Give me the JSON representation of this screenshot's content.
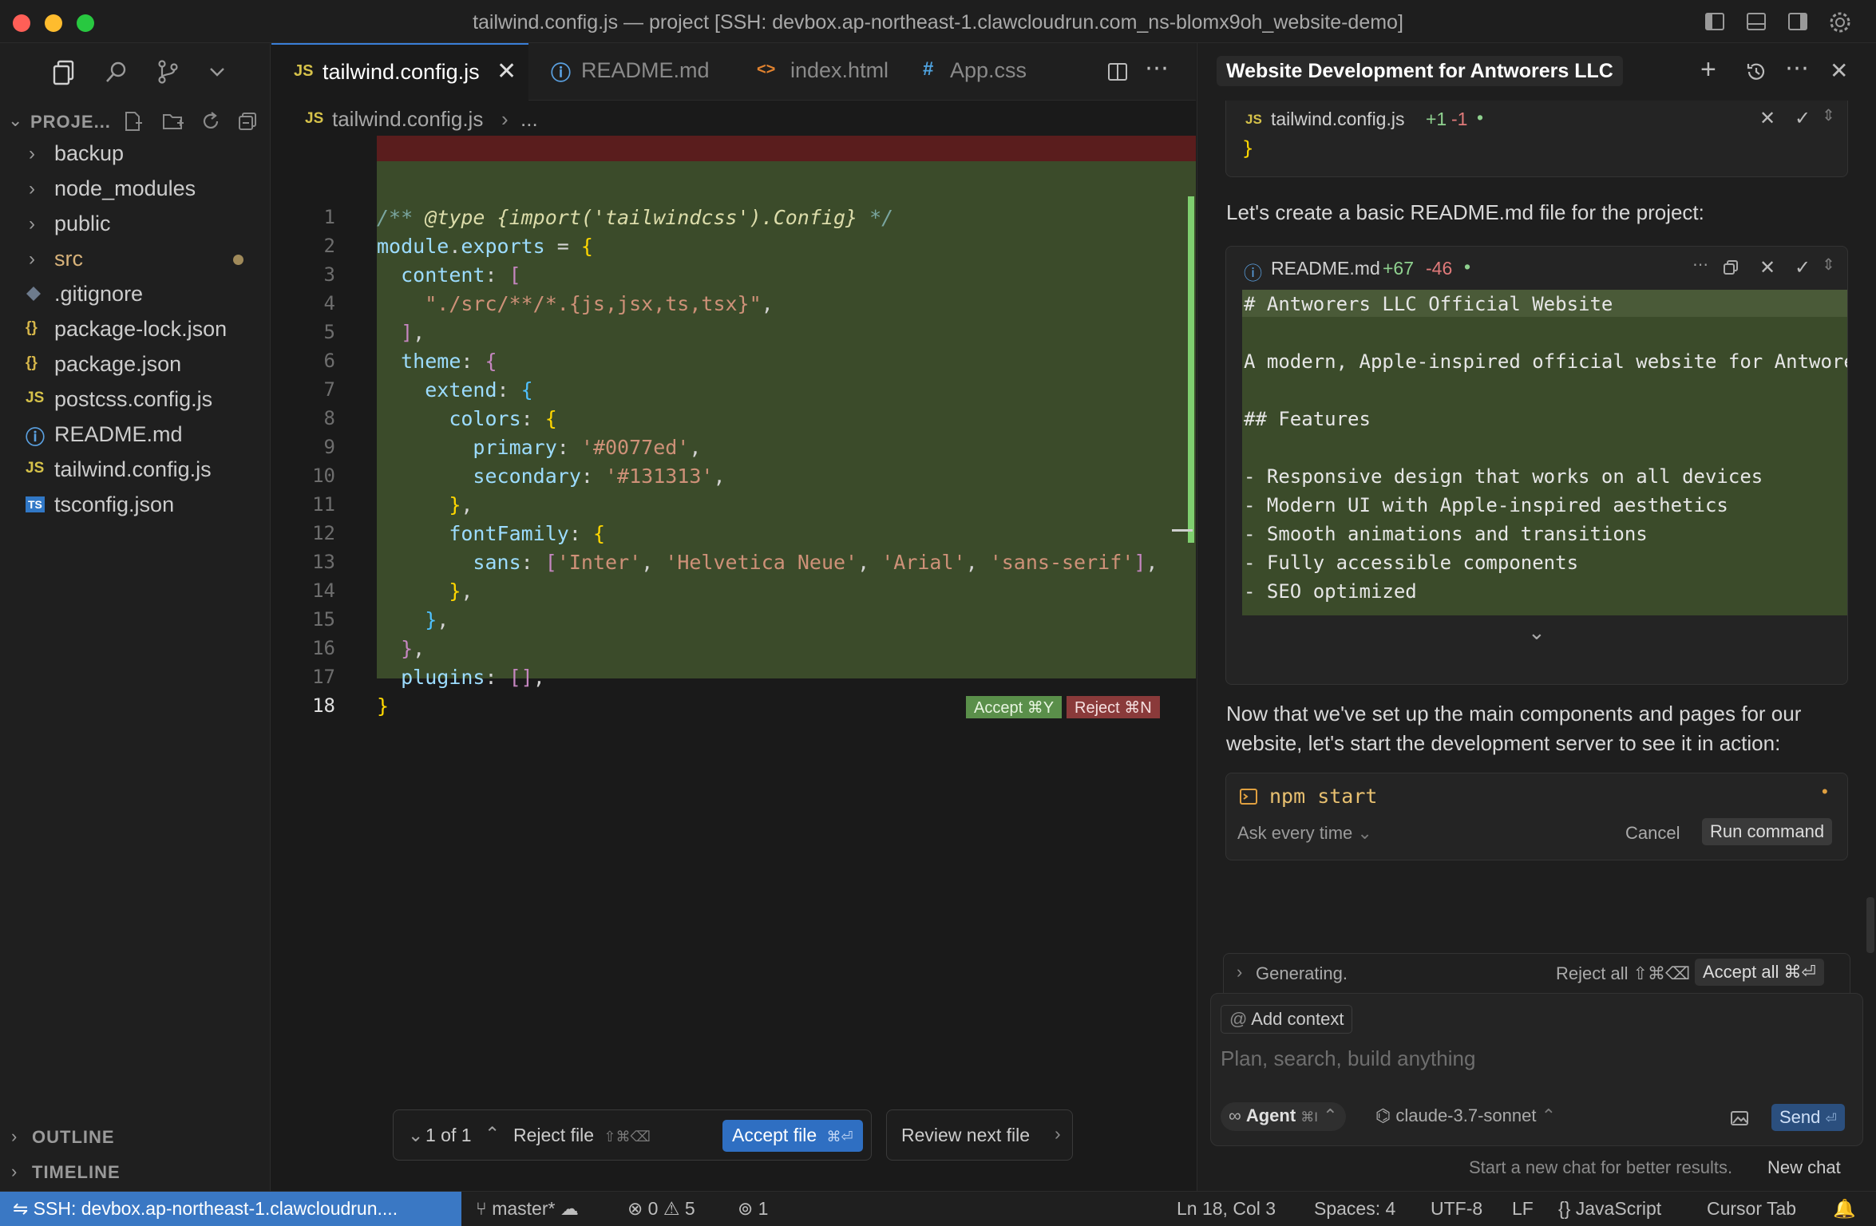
{
  "window": {
    "title": "tailwind.config.js — project [SSH: devbox.ap-northeast-1.clawcloudrun.com_ns-blomx9oh_website-demo]"
  },
  "explorer": {
    "title": "PROJE...",
    "items": [
      {
        "label": "backup",
        "kind": "folder"
      },
      {
        "label": "node_modules",
        "kind": "folder"
      },
      {
        "label": "public",
        "kind": "folder"
      },
      {
        "label": "src",
        "kind": "folder"
      },
      {
        "label": ".gitignore",
        "kind": "git"
      },
      {
        "label": "package-lock.json",
        "kind": "json",
        "icon": "{}"
      },
      {
        "label": "package.json",
        "kind": "json",
        "icon": "{}"
      },
      {
        "label": "postcss.config.js",
        "kind": "js",
        "icon": "JS"
      },
      {
        "label": "README.md",
        "kind": "info",
        "icon": "ⓘ"
      },
      {
        "label": "tailwind.config.js",
        "kind": "js",
        "icon": "JS"
      },
      {
        "label": "tsconfig.json",
        "kind": "ts",
        "icon": "TS"
      }
    ],
    "outline": "OUTLINE",
    "timeline": "TIMELINE"
  },
  "tabs": [
    {
      "label": "tailwind.config.js",
      "icon": "JS"
    },
    {
      "label": "README.md",
      "icon": "ⓘ"
    },
    {
      "label": "index.html",
      "icon": "<>"
    },
    {
      "label": "App.css",
      "icon": "#"
    }
  ],
  "breadcrumb": {
    "file": "tailwind.config.js",
    "rest": "..."
  },
  "code": {
    "line_numbers": [
      "1",
      "2",
      "3",
      "4",
      "5",
      "6",
      "7",
      "8",
      "9",
      "10",
      "11",
      "12",
      "13",
      "14",
      "15",
      "16",
      "17",
      "18"
    ],
    "accept_label": "Accept ⌘Y",
    "reject_label": "Reject ⌘N"
  },
  "review_bar": {
    "counter": "1 of 1",
    "reject_file": "Reject file",
    "reject_shortcut": "⇧⌘⌫",
    "accept_file": "Accept file",
    "accept_shortcut": "⌘⏎",
    "review_next": "Review next file"
  },
  "chat": {
    "title": "Website Development for Antworers LLC",
    "file_card_1": {
      "name": "tailwind.config.js",
      "added": "+1",
      "removed": "-1",
      "brace": "}"
    },
    "msg_1": "Let's create a basic README.md file for the project:",
    "file_card_2": {
      "name": "README.md",
      "added": "+67",
      "removed": "-46",
      "lines": [
        "# Antworers LLC Official Website",
        "",
        "A modern, Apple-inspired official website for Antwore",
        "",
        "## Features",
        "",
        "- Responsive design that works on all devices",
        "- Modern UI with Apple-inspired aesthetics",
        "- Smooth animations and transitions",
        "- Fully accessible components",
        "- SEO optimized"
      ]
    },
    "msg_2": "Now that we've set up the main components and pages for our website, let's start the development server to see it in action:",
    "command_card": {
      "command": "npm start",
      "mode": "Ask every time",
      "cancel": "Cancel",
      "run": "Run command"
    },
    "generating": {
      "label": "Generating.",
      "reject_all": "Reject all ⇧⌘⌫",
      "accept_all": "Accept all ⌘⏎"
    },
    "composer": {
      "add_context": "Add context",
      "placeholder": "Plan, search, build anything",
      "agent": "Agent",
      "agent_shortcut": "⌘I",
      "model": "claude-3.7-sonnet",
      "send": "Send"
    },
    "footer": {
      "hint": "Start a new chat for better results.",
      "new_chat": "New chat"
    }
  },
  "status": {
    "remote": "SSH: devbox.ap-northeast-1.clawcloudrun....",
    "branch": "master*",
    "errors": "0",
    "warnings": "5",
    "ports": "1",
    "position": "Ln 18, Col 3",
    "spaces": "Spaces: 4",
    "encoding": "UTF-8",
    "eol": "LF",
    "language": "JavaScript",
    "cursor_tab": "Cursor Tab"
  },
  "colors": {
    "accent": "#3a78c4",
    "diff_added_bg": "#3b4b2a",
    "diff_removed_bg": "#5a1d1d",
    "accept_green": "#6fae5f",
    "reject_red": "#c0504d"
  }
}
